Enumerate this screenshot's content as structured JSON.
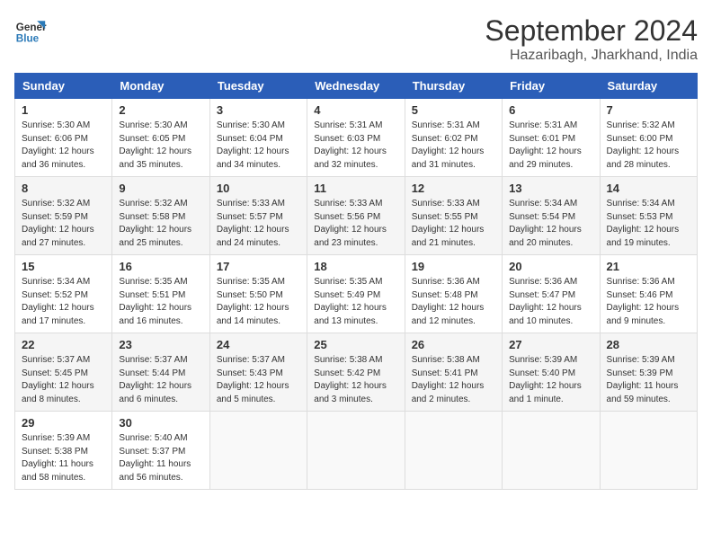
{
  "header": {
    "logo_line1": "General",
    "logo_line2": "Blue",
    "title": "September 2024",
    "subtitle": "Hazaribagh, Jharkhand, India"
  },
  "weekdays": [
    "Sunday",
    "Monday",
    "Tuesday",
    "Wednesday",
    "Thursday",
    "Friday",
    "Saturday"
  ],
  "weeks": [
    [
      {
        "day": "1",
        "info": "Sunrise: 5:30 AM\nSunset: 6:06 PM\nDaylight: 12 hours\nand 36 minutes."
      },
      {
        "day": "2",
        "info": "Sunrise: 5:30 AM\nSunset: 6:05 PM\nDaylight: 12 hours\nand 35 minutes."
      },
      {
        "day": "3",
        "info": "Sunrise: 5:30 AM\nSunset: 6:04 PM\nDaylight: 12 hours\nand 34 minutes."
      },
      {
        "day": "4",
        "info": "Sunrise: 5:31 AM\nSunset: 6:03 PM\nDaylight: 12 hours\nand 32 minutes."
      },
      {
        "day": "5",
        "info": "Sunrise: 5:31 AM\nSunset: 6:02 PM\nDaylight: 12 hours\nand 31 minutes."
      },
      {
        "day": "6",
        "info": "Sunrise: 5:31 AM\nSunset: 6:01 PM\nDaylight: 12 hours\nand 29 minutes."
      },
      {
        "day": "7",
        "info": "Sunrise: 5:32 AM\nSunset: 6:00 PM\nDaylight: 12 hours\nand 28 minutes."
      }
    ],
    [
      {
        "day": "8",
        "info": "Sunrise: 5:32 AM\nSunset: 5:59 PM\nDaylight: 12 hours\nand 27 minutes."
      },
      {
        "day": "9",
        "info": "Sunrise: 5:32 AM\nSunset: 5:58 PM\nDaylight: 12 hours\nand 25 minutes."
      },
      {
        "day": "10",
        "info": "Sunrise: 5:33 AM\nSunset: 5:57 PM\nDaylight: 12 hours\nand 24 minutes."
      },
      {
        "day": "11",
        "info": "Sunrise: 5:33 AM\nSunset: 5:56 PM\nDaylight: 12 hours\nand 23 minutes."
      },
      {
        "day": "12",
        "info": "Sunrise: 5:33 AM\nSunset: 5:55 PM\nDaylight: 12 hours\nand 21 minutes."
      },
      {
        "day": "13",
        "info": "Sunrise: 5:34 AM\nSunset: 5:54 PM\nDaylight: 12 hours\nand 20 minutes."
      },
      {
        "day": "14",
        "info": "Sunrise: 5:34 AM\nSunset: 5:53 PM\nDaylight: 12 hours\nand 19 minutes."
      }
    ],
    [
      {
        "day": "15",
        "info": "Sunrise: 5:34 AM\nSunset: 5:52 PM\nDaylight: 12 hours\nand 17 minutes."
      },
      {
        "day": "16",
        "info": "Sunrise: 5:35 AM\nSunset: 5:51 PM\nDaylight: 12 hours\nand 16 minutes."
      },
      {
        "day": "17",
        "info": "Sunrise: 5:35 AM\nSunset: 5:50 PM\nDaylight: 12 hours\nand 14 minutes."
      },
      {
        "day": "18",
        "info": "Sunrise: 5:35 AM\nSunset: 5:49 PM\nDaylight: 12 hours\nand 13 minutes."
      },
      {
        "day": "19",
        "info": "Sunrise: 5:36 AM\nSunset: 5:48 PM\nDaylight: 12 hours\nand 12 minutes."
      },
      {
        "day": "20",
        "info": "Sunrise: 5:36 AM\nSunset: 5:47 PM\nDaylight: 12 hours\nand 10 minutes."
      },
      {
        "day": "21",
        "info": "Sunrise: 5:36 AM\nSunset: 5:46 PM\nDaylight: 12 hours\nand 9 minutes."
      }
    ],
    [
      {
        "day": "22",
        "info": "Sunrise: 5:37 AM\nSunset: 5:45 PM\nDaylight: 12 hours\nand 8 minutes."
      },
      {
        "day": "23",
        "info": "Sunrise: 5:37 AM\nSunset: 5:44 PM\nDaylight: 12 hours\nand 6 minutes."
      },
      {
        "day": "24",
        "info": "Sunrise: 5:37 AM\nSunset: 5:43 PM\nDaylight: 12 hours\nand 5 minutes."
      },
      {
        "day": "25",
        "info": "Sunrise: 5:38 AM\nSunset: 5:42 PM\nDaylight: 12 hours\nand 3 minutes."
      },
      {
        "day": "26",
        "info": "Sunrise: 5:38 AM\nSunset: 5:41 PM\nDaylight: 12 hours\nand 2 minutes."
      },
      {
        "day": "27",
        "info": "Sunrise: 5:39 AM\nSunset: 5:40 PM\nDaylight: 12 hours\nand 1 minute."
      },
      {
        "day": "28",
        "info": "Sunrise: 5:39 AM\nSunset: 5:39 PM\nDaylight: 11 hours\nand 59 minutes."
      }
    ],
    [
      {
        "day": "29",
        "info": "Sunrise: 5:39 AM\nSunset: 5:38 PM\nDaylight: 11 hours\nand 58 minutes."
      },
      {
        "day": "30",
        "info": "Sunrise: 5:40 AM\nSunset: 5:37 PM\nDaylight: 11 hours\nand 56 minutes."
      },
      {
        "day": "",
        "info": ""
      },
      {
        "day": "",
        "info": ""
      },
      {
        "day": "",
        "info": ""
      },
      {
        "day": "",
        "info": ""
      },
      {
        "day": "",
        "info": ""
      }
    ]
  ]
}
